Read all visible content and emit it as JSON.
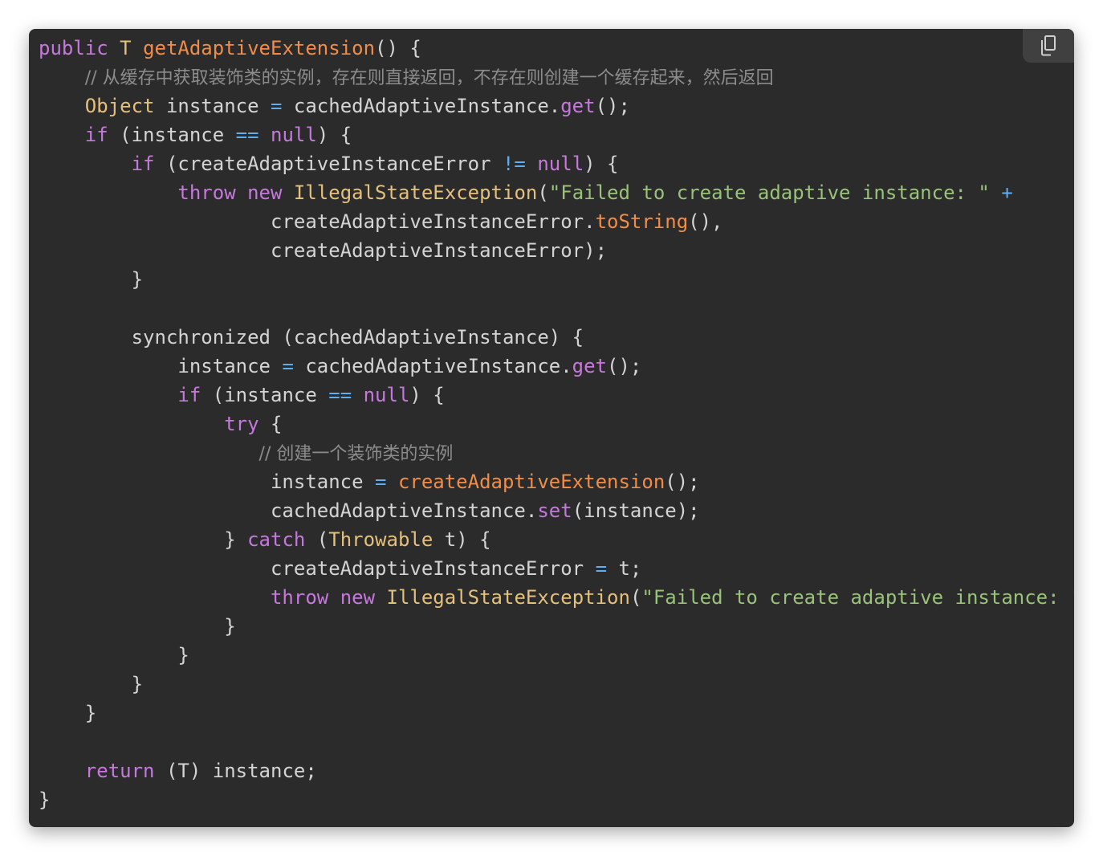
{
  "copy_button": {
    "icon": "copy-icon"
  },
  "theme": {
    "background": "#2b2b2b",
    "keyword": "#c678dd",
    "type": "#e5c07b",
    "function": "#f08d49",
    "string": "#98c379",
    "operator": "#61aeee",
    "comment": "#8c8c8c",
    "plain": "#d4d4d4"
  },
  "code": {
    "lines": [
      [
        [
          "kw",
          "public"
        ],
        [
          "pl",
          " "
        ],
        [
          "ty",
          "T"
        ],
        [
          "pl",
          " "
        ],
        [
          "fn",
          "getAdaptiveExtension"
        ],
        [
          "pl",
          "() {"
        ]
      ],
      [
        [
          "pl",
          "    "
        ],
        [
          "cm",
          "// 从缓存中获取装饰类的实例，存在则直接返回，不存在则创建一个缓存起来，然后返回"
        ]
      ],
      [
        [
          "pl",
          "    "
        ],
        [
          "ty",
          "Object"
        ],
        [
          "pl",
          " instance "
        ],
        [
          "op",
          "="
        ],
        [
          "pl",
          " cachedAdaptiveInstance."
        ],
        [
          "kw",
          "get"
        ],
        [
          "pl",
          "();"
        ]
      ],
      [
        [
          "pl",
          "    "
        ],
        [
          "kw",
          "if"
        ],
        [
          "pl",
          " (instance "
        ],
        [
          "op",
          "=="
        ],
        [
          "pl",
          " "
        ],
        [
          "kw",
          "null"
        ],
        [
          "pl",
          ") {"
        ]
      ],
      [
        [
          "pl",
          "        "
        ],
        [
          "kw",
          "if"
        ],
        [
          "pl",
          " (createAdaptiveInstanceError "
        ],
        [
          "op",
          "!="
        ],
        [
          "pl",
          " "
        ],
        [
          "kw",
          "null"
        ],
        [
          "pl",
          ") {"
        ]
      ],
      [
        [
          "pl",
          "            "
        ],
        [
          "kw",
          "throw"
        ],
        [
          "pl",
          " "
        ],
        [
          "kw",
          "new"
        ],
        [
          "pl",
          " "
        ],
        [
          "ty",
          "IllegalStateException"
        ],
        [
          "pl",
          "("
        ],
        [
          "str",
          "\"Failed to create adaptive instance: \""
        ],
        [
          "pl",
          " "
        ],
        [
          "op",
          "+"
        ]
      ],
      [
        [
          "pl",
          "                    createAdaptiveInstanceError."
        ],
        [
          "fn",
          "toString"
        ],
        [
          "pl",
          "(),"
        ]
      ],
      [
        [
          "pl",
          "                    createAdaptiveInstanceError);"
        ]
      ],
      [
        [
          "pl",
          "        }"
        ]
      ],
      [
        [
          "pl",
          ""
        ]
      ],
      [
        [
          "pl",
          "        synchronized (cachedAdaptiveInstance) {"
        ]
      ],
      [
        [
          "pl",
          "            instance "
        ],
        [
          "op",
          "="
        ],
        [
          "pl",
          " cachedAdaptiveInstance."
        ],
        [
          "kw",
          "get"
        ],
        [
          "pl",
          "();"
        ]
      ],
      [
        [
          "pl",
          "            "
        ],
        [
          "kw",
          "if"
        ],
        [
          "pl",
          " (instance "
        ],
        [
          "op",
          "=="
        ],
        [
          "pl",
          " "
        ],
        [
          "kw",
          "null"
        ],
        [
          "pl",
          ") {"
        ]
      ],
      [
        [
          "pl",
          "                "
        ],
        [
          "kw",
          "try"
        ],
        [
          "pl",
          " {"
        ]
      ],
      [
        [
          "pl",
          "                   "
        ],
        [
          "cm",
          "// 创建一个装饰类的实例"
        ]
      ],
      [
        [
          "pl",
          "                    instance "
        ],
        [
          "op",
          "="
        ],
        [
          "pl",
          " "
        ],
        [
          "fn",
          "createAdaptiveExtension"
        ],
        [
          "pl",
          "();"
        ]
      ],
      [
        [
          "pl",
          "                    cachedAdaptiveInstance."
        ],
        [
          "kw",
          "set"
        ],
        [
          "pl",
          "(instance);"
        ]
      ],
      [
        [
          "pl",
          "                } "
        ],
        [
          "kw",
          "catch"
        ],
        [
          "pl",
          " ("
        ],
        [
          "ty",
          "Throwable"
        ],
        [
          "pl",
          " t) {"
        ]
      ],
      [
        [
          "pl",
          "                    createAdaptiveInstanceError "
        ],
        [
          "op",
          "="
        ],
        [
          "pl",
          " t;"
        ]
      ],
      [
        [
          "pl",
          "                    "
        ],
        [
          "kw",
          "throw"
        ],
        [
          "pl",
          " "
        ],
        [
          "kw",
          "new"
        ],
        [
          "pl",
          " "
        ],
        [
          "ty",
          "IllegalStateException"
        ],
        [
          "pl",
          "("
        ],
        [
          "str",
          "\"Failed to create adaptive instance: \""
        ]
      ],
      [
        [
          "pl",
          "                }"
        ]
      ],
      [
        [
          "pl",
          "            }"
        ]
      ],
      [
        [
          "pl",
          "        }"
        ]
      ],
      [
        [
          "pl",
          "    }"
        ]
      ],
      [
        [
          "pl",
          ""
        ]
      ],
      [
        [
          "pl",
          "    "
        ],
        [
          "kw",
          "return"
        ],
        [
          "pl",
          " (T) instance;"
        ]
      ],
      [
        [
          "pl",
          "}"
        ]
      ]
    ]
  }
}
